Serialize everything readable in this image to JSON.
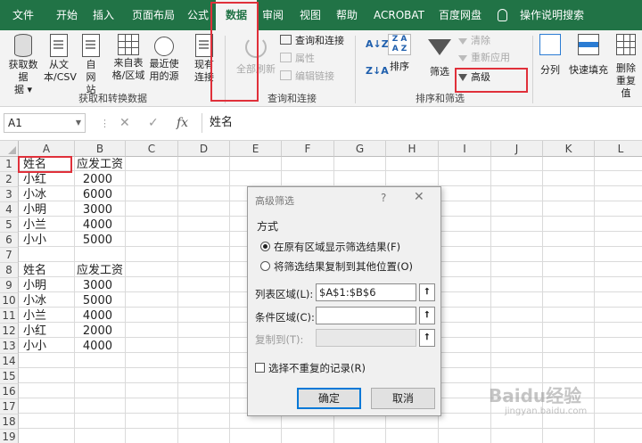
{
  "menu": {
    "tabs": [
      "文件",
      "开始",
      "插入",
      "页面布局",
      "公式",
      "数据",
      "审阅",
      "视图",
      "帮助",
      "ACROBAT",
      "百度网盘",
      "操作说明搜索"
    ],
    "active_tab": "数据"
  },
  "ribbon": {
    "get_data": "获取数据",
    "get_data_arrow": "据 ▾",
    "from_text": "从文本/CSV",
    "from_web": "自网站",
    "from_table": "来自表格/区域",
    "recent_sources": "最近使用的源",
    "existing_conn": "现有连接",
    "group_get": "获取和转换数据",
    "refresh_all": "全部刷新",
    "queries_conn": "查询和连接",
    "properties": "属性",
    "edit_links": "编辑链接",
    "group_queries": "查询和连接",
    "sort_az": "A↓Z",
    "sort_za": "Z↓A",
    "sort": "排序",
    "filter": "筛选",
    "clear": "清除",
    "reapply": "重新应用",
    "advanced": "高级",
    "group_sort": "排序和筛选",
    "text_to_cols": "分列",
    "flash_fill": "快速填充",
    "remove_dup": "删除重复值"
  },
  "formula_bar": {
    "name_box": "A1",
    "cancel": "✕",
    "enter": "✓",
    "fx": "fx",
    "content": "姓名"
  },
  "sheet": {
    "columns": [
      "A",
      "B",
      "C",
      "D",
      "E",
      "F",
      "G",
      "H",
      "I",
      "J",
      "K",
      "L"
    ],
    "rows": [
      "1",
      "2",
      "3",
      "4",
      "5",
      "6",
      "7",
      "8",
      "9",
      "10",
      "11",
      "12",
      "13",
      "14",
      "15",
      "16",
      "17",
      "18",
      "19"
    ],
    "table1": {
      "headers": [
        "姓名",
        "应发工资"
      ],
      "rows": [
        [
          "小红",
          "2000"
        ],
        [
          "小冰",
          "6000"
        ],
        [
          "小明",
          "3000"
        ],
        [
          "小兰",
          "4000"
        ],
        [
          "小小",
          "5000"
        ]
      ]
    },
    "table2": {
      "headers": [
        "姓名",
        "应发工资"
      ],
      "rows": [
        [
          "小明",
          "3000"
        ],
        [
          "小冰",
          "5000"
        ],
        [
          "小兰",
          "4000"
        ],
        [
          "小红",
          "2000"
        ],
        [
          "小小",
          "4000"
        ]
      ]
    }
  },
  "dialog": {
    "title": "高级筛选",
    "help": "?",
    "close": "✕",
    "section": "方式",
    "option1": "在原有区域显示筛选结果(F)",
    "option2": "将筛选结果复制到其他位置(O)",
    "list_range_label": "列表区域(L):",
    "list_range_value": "$A$1:$B$6",
    "criteria_label": "条件区域(C):",
    "criteria_value": "",
    "copy_to_label": "复制到(T):",
    "copy_to_value": "",
    "unique_label": "选择不重复的记录(R)",
    "ok": "确定",
    "cancel": "取消",
    "picker_glyph": "⭡"
  },
  "watermark": {
    "text": "Baidu经验",
    "url": "jingyan.baidu.com"
  },
  "colors": {
    "excel_green": "#217346",
    "highlight_red": "#e0303a",
    "accent_blue": "#0078d7"
  }
}
